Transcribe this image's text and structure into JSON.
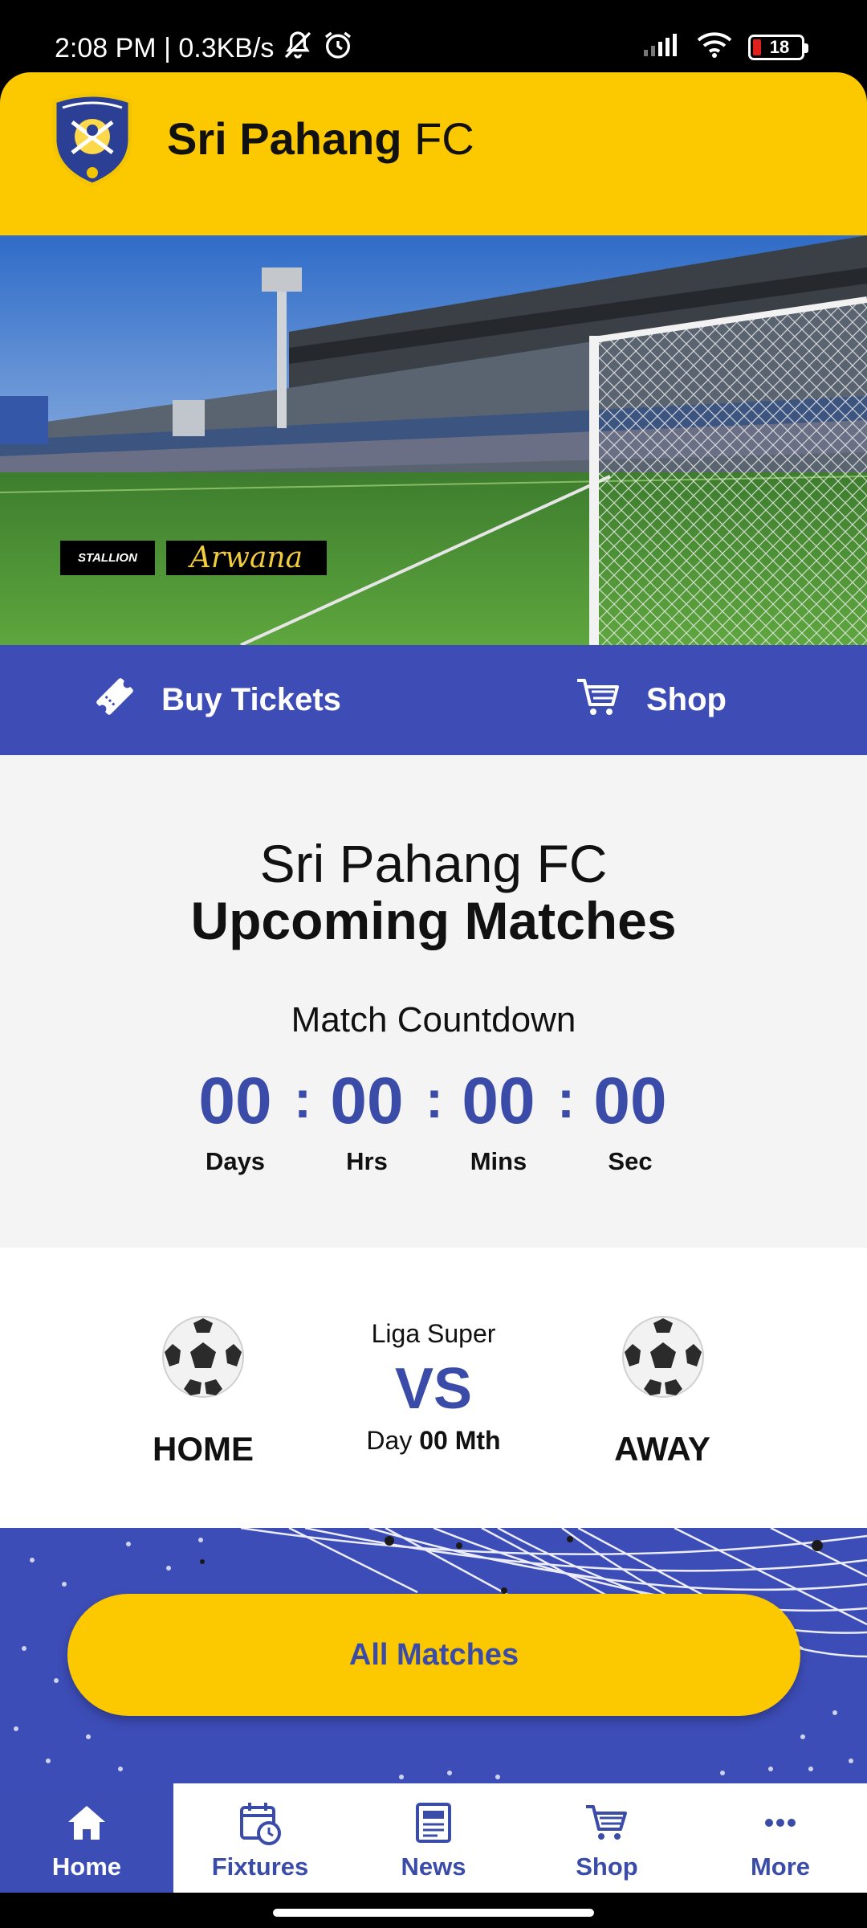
{
  "status_bar": {
    "time_speed": "2:08 PM | 0.3KB/s",
    "battery": "18",
    "icons": [
      "mute-icon",
      "alarm-icon",
      "signal-icon",
      "wifi-icon",
      "battery-icon"
    ]
  },
  "header": {
    "title_bold": "Sri Pahang",
    "title_regular": "FC",
    "logo": "club-crest"
  },
  "hero": {
    "sponsors": [
      "STALLION",
      "Arwana"
    ]
  },
  "actions": {
    "buy_tickets": "Buy Tickets",
    "shop": "Shop"
  },
  "countdown": {
    "club": "Sri Pahang FC",
    "heading": "Upcoming Matches",
    "label": "Match Countdown",
    "separator": ":",
    "units": [
      {
        "value": "00",
        "label": "Days"
      },
      {
        "value": "00",
        "label": "Hrs"
      },
      {
        "value": "00",
        "label": "Mins"
      },
      {
        "value": "00",
        "label": "Sec"
      }
    ]
  },
  "match": {
    "league": "Liga Super",
    "vs": "VS",
    "date_prefix": "Day",
    "date_value": "00 Mth",
    "home": "HOME",
    "away": "AWAY"
  },
  "all_matches": {
    "label": "All Matches"
  },
  "bottom_nav": {
    "items": [
      {
        "label": "Home",
        "icon": "home-icon",
        "active": true
      },
      {
        "label": "Fixtures",
        "icon": "calendar-clock-icon",
        "active": false
      },
      {
        "label": "News",
        "icon": "newspaper-icon",
        "active": false
      },
      {
        "label": "Shop",
        "icon": "cart-icon",
        "active": false
      },
      {
        "label": "More",
        "icon": "more-icon",
        "active": false
      }
    ]
  },
  "colors": {
    "brand_yellow": "#fcc800",
    "brand_blue": "#3e4db6",
    "accent_blue_text": "#3a4ca8"
  }
}
